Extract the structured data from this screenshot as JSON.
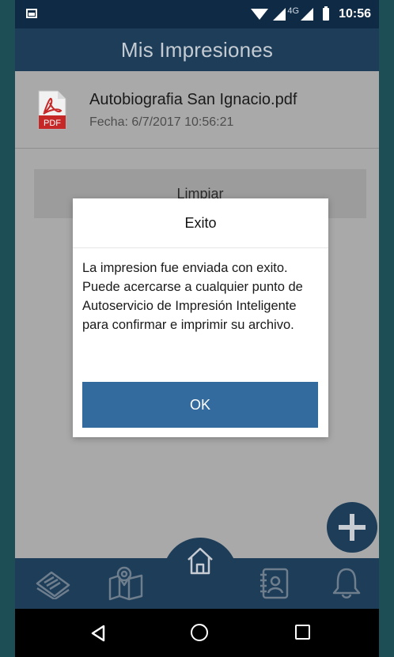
{
  "status_bar": {
    "network_label": "4G",
    "time": "10:56"
  },
  "header": {
    "title": "Mis Impresiones"
  },
  "files": [
    {
      "name": "Autobiografia San Ignacio.pdf",
      "date": "Fecha: 6/7/2017 10:56:21",
      "icon": "pdf-file-icon",
      "icon_label": "PDF"
    }
  ],
  "actions": {
    "clear_label": "Limpiar"
  },
  "dialog": {
    "title": "Exito",
    "message": "La impresion fue enviada con exito. Puede acercarse a cualquier punto de Autoservicio de Impresión Inteligente para confirmar e imprimir su archivo.",
    "ok_label": "OK"
  },
  "bottom_nav": {
    "items": [
      "tickets-icon",
      "map-icon",
      "home-icon",
      "contacts-icon",
      "bell-icon"
    ]
  },
  "colors": {
    "primary": "#1d3d59",
    "button": "#346b9f",
    "pdf_red": "#c62828"
  }
}
